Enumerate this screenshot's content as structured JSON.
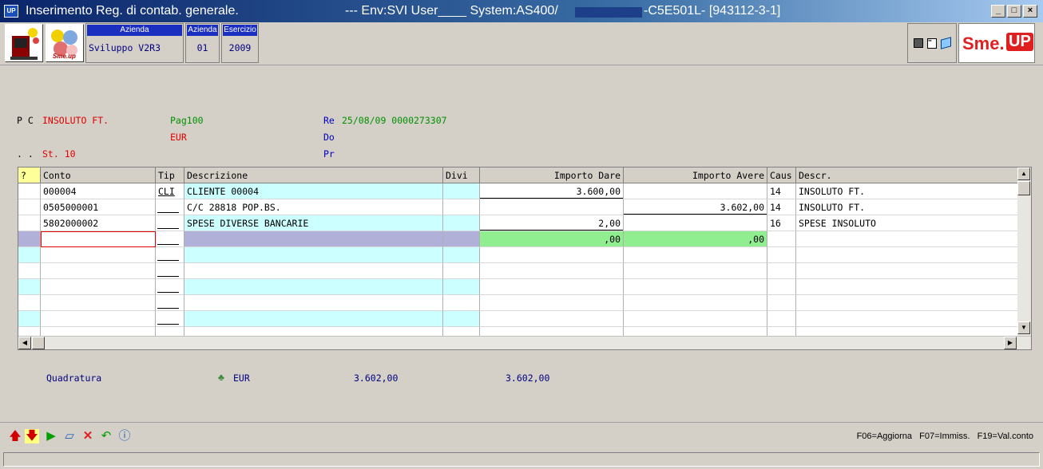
{
  "window": {
    "title": "Inserimento Reg. di contab. generale.",
    "env_text": "--- Env:SVI User____ System:AS400/",
    "env_suffix": "-C5E501L- [943112-3-1]",
    "app_icon": "UP",
    "buttons": {
      "minimize": "_",
      "maximize": "□",
      "close": "×"
    }
  },
  "header": {
    "azienda_label": "Azienda",
    "azienda_value": "Sviluppo V2R3",
    "azienda_code_label": "Azienda",
    "azienda_code_value": "01",
    "esercizio_label": "Esercizio",
    "esercizio_value": "2009",
    "brand": "Sme.",
    "brand_badge": "UP"
  },
  "info": {
    "pc_label": "P C",
    "description": "INSOLUTO FT.",
    "pag": "Pag100",
    "currency": "EUR",
    "dots": ". .",
    "status": "St. 10",
    "re_label": "Re",
    "re_value": "25/08/09 0000273307",
    "do_label": "Do",
    "pr_label": "Pr"
  },
  "grid": {
    "columns": [
      "?",
      "Conto",
      "Tip",
      "Descrizione",
      "Divi",
      "Importo Dare",
      "Importo Avere",
      "Caus",
      "Descr."
    ],
    "rows": [
      {
        "conto": "000004",
        "tip": "CLI",
        "descrizione": "CLIENTE 00004",
        "dare": "3.600,00",
        "avere": "",
        "caus": "14",
        "descr": "INSOLUTO FT."
      },
      {
        "conto": "0505000001",
        "tip": "",
        "descrizione": "C/C 28818 POP.BS.",
        "dare": "",
        "avere": "3.602,00",
        "caus": "14",
        "descr": "INSOLUTO FT."
      },
      {
        "conto": "5802000002",
        "tip": "",
        "descrizione": "SPESE DIVERSE BANCARIE",
        "dare": "2,00",
        "avere": "",
        "caus": "16",
        "descr": "SPESE INSOLUTO"
      },
      {
        "conto": "",
        "tip": "",
        "descrizione": "",
        "dare": ",00",
        "avere": ",00",
        "caus": "",
        "descr": ""
      }
    ]
  },
  "quadratura": {
    "label": "Quadratura",
    "currency": "EUR",
    "total_dare": "3.602,00",
    "total_avere": "3.602,00"
  },
  "function_keys": "F06=Aggiorna   F07=Immiss.   F19=Val.conto"
}
